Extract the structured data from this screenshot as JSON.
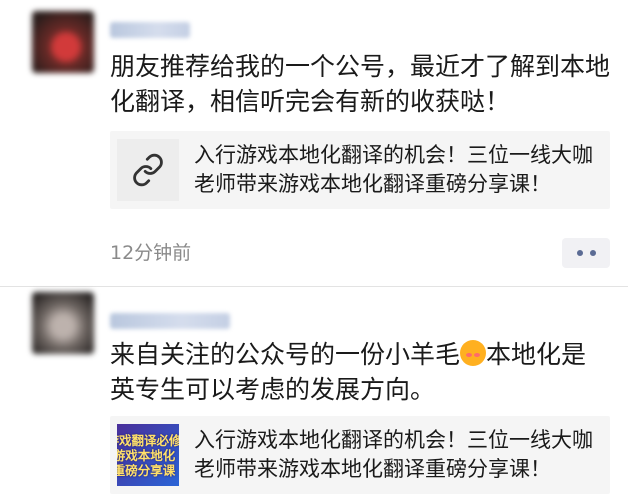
{
  "posts": [
    {
      "content": "朋友推荐给我的一个公号，最近才了解到本地化翻译，相信听完会有新的收获哒！",
      "link": {
        "title": "入行游戏本地化翻译的机会！三位一线大咖老师带来游戏本地化翻译重磅分享课！",
        "thumbnail": "link-icon"
      },
      "time": "12分钟前",
      "more_icon": "more-dots-icon"
    },
    {
      "content_before_emoji": "来自关注的公众号的一份小羊毛",
      "emoji": "smiling-face-with-hearts-icon",
      "content_after_emoji": "本地化是英专生可以考虑的发展方向。",
      "link": {
        "title": "入行游戏本地化翻译的机会！三位一线大咖老师带来游戏本地化翻译重磅分享课！",
        "thumbnail_lines": [
          "游戏翻译必修",
          "游戏本地化",
          "重磅分享课"
        ]
      }
    }
  ],
  "colors": {
    "text": "#1a1a1a",
    "meta": "#8a8a8a",
    "card_bg": "#f5f5f5",
    "more_dots": "#5b6b94"
  }
}
